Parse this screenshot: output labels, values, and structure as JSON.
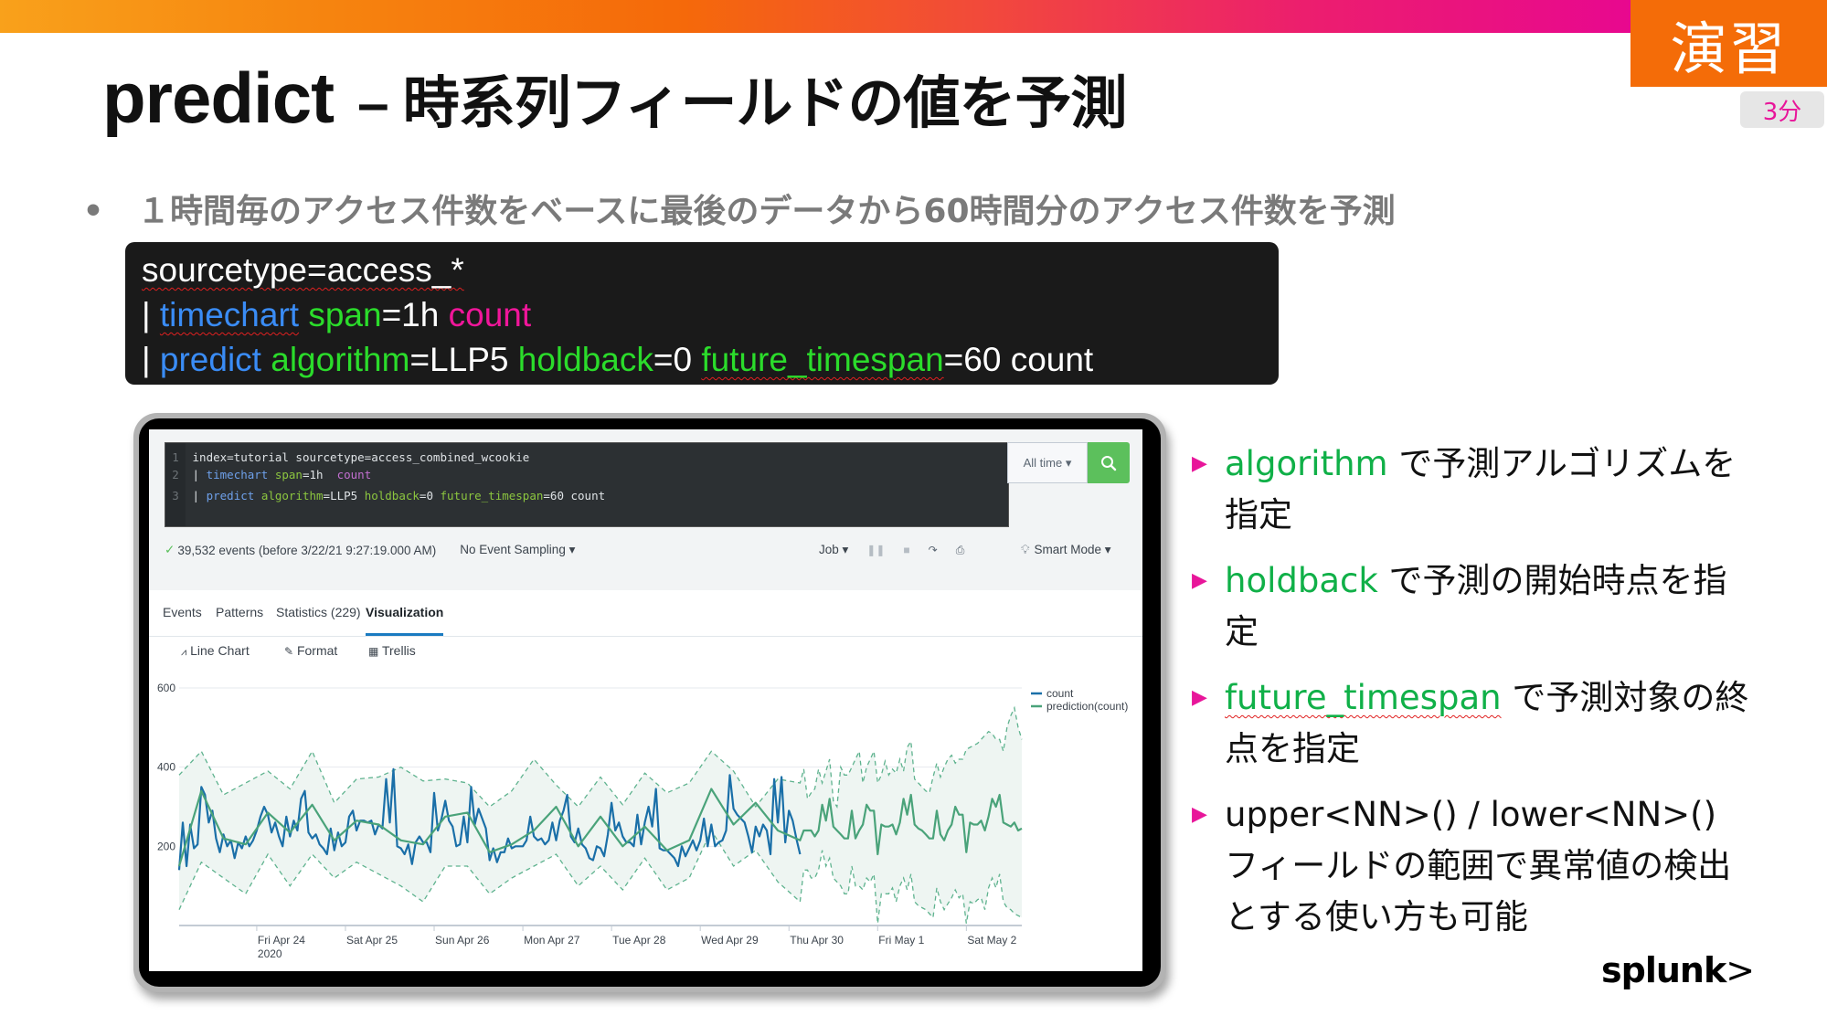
{
  "slide": {
    "title_main": "predict",
    "title_sub": "– 時系列フィールドの値を予測",
    "badge": "演習",
    "duration": "3分",
    "bullet_dot": "•",
    "bullet": "１時間毎のアクセス件数をベースに最後のデータから60時間分のアクセス件数を予測",
    "logo": "splunk",
    "logo_mark": ">"
  },
  "code": {
    "line1": {
      "text": "sourcetype=access_*"
    },
    "line2": {
      "pipe": "| ",
      "cmd": "timechart",
      "arg": "span",
      "val": "=1h ",
      "fn": "count"
    },
    "line3": {
      "pipe": "| ",
      "cmd": "predict",
      "a1": "algorithm",
      "v1": "=LLP5 ",
      "a2": "holdback",
      "v2": "=0 ",
      "a3": "future_timespan",
      "v3": "=60 count"
    }
  },
  "splunk_ui": {
    "search": {
      "lines": [
        {
          "n": "1",
          "text": "index=tutorial sourcetype=access_combined_wcookie"
        },
        {
          "n": "2",
          "pipe": "| ",
          "cmd": "timechart",
          "arg": "span",
          "rest": "=1h  ",
          "fn": "count"
        },
        {
          "n": "3",
          "pipe": "| ",
          "cmd": "predict",
          "a1": "algorithm",
          "v1": "=LLP5 ",
          "a2": "holdback",
          "v2": "=0 ",
          "a3": "future_timespan",
          "v3": "=60 count"
        }
      ],
      "time_range": "All time ▾",
      "search_icon": "search-icon"
    },
    "status": {
      "check": "✓",
      "events": "39,532 events (before 3/22/21 9:27:19.000 AM)",
      "sampling": "No Event Sampling ▾",
      "job": "Job ▾",
      "mode": "Smart Mode ▾"
    },
    "tabs": [
      {
        "label": "Events",
        "active": false
      },
      {
        "label": "Patterns",
        "active": false
      },
      {
        "label": "Statistics (229)",
        "active": false
      },
      {
        "label": "Visualization",
        "active": true
      }
    ],
    "viz_tools": [
      {
        "icon": "line-chart-icon",
        "glyph": "⩘",
        "label": "Line Chart"
      },
      {
        "icon": "pencil-icon",
        "glyph": "✎",
        "label": "Format"
      },
      {
        "icon": "trellis-icon",
        "glyph": "▦",
        "label": "Trellis"
      }
    ]
  },
  "right_bullets": [
    {
      "keyword": "algorithm",
      "text": " で予測アルゴリズムを指定"
    },
    {
      "keyword": "holdback",
      "text": " で予測の開始時点を指定"
    },
    {
      "keyword": "future_timespan",
      "text": " で予測対象の終点を指定"
    },
    {
      "keyword": "",
      "text": "upper<NN>() / lower<NN>() フィールドの範囲で異常値の検出とする使い方も可能"
    }
  ],
  "colors": {
    "accent_orange": "#f46c08",
    "accent_pink": "#e8169a",
    "keyword_green": "#10b048",
    "count_line": "#1a6fa8",
    "prediction_line": "#4aa37a",
    "search_button": "#5cc05c"
  },
  "chart_data": {
    "type": "line",
    "title": "",
    "xlabel": "",
    "ylabel": "",
    "ylim": [
      0,
      600
    ],
    "yticks": [
      200,
      400,
      600
    ],
    "grid": true,
    "legend": "right",
    "x_unit": "hours since axis start (Thu Apr 23 ~03:00, 2020)",
    "xlim": [
      0,
      228
    ],
    "xticks": [
      {
        "hour": 21,
        "label": "Fri Apr 24",
        "sub": "2020"
      },
      {
        "hour": 45,
        "label": "Sat Apr 25",
        "sub": ""
      },
      {
        "hour": 69,
        "label": "Sun Apr 26",
        "sub": ""
      },
      {
        "hour": 93,
        "label": "Mon Apr 27",
        "sub": ""
      },
      {
        "hour": 117,
        "label": "Tue Apr 28",
        "sub": ""
      },
      {
        "hour": 141,
        "label": "Wed Apr 29",
        "sub": ""
      },
      {
        "hour": 165,
        "label": "Thu Apr 30",
        "sub": ""
      },
      {
        "hour": 189,
        "label": "Fri May 1",
        "sub": ""
      },
      {
        "hour": 213,
        "label": "Sat May 2",
        "sub": ""
      }
    ],
    "series": [
      {
        "name": "count",
        "x": [
          0,
          1,
          2,
          3,
          4,
          5,
          6,
          7,
          8,
          9,
          10,
          11,
          12,
          13,
          14,
          15,
          16,
          17,
          18,
          19,
          20,
          21,
          22,
          23,
          24,
          25,
          26,
          27,
          28,
          29,
          30,
          31,
          32,
          33,
          34,
          35,
          36,
          37,
          38,
          39,
          40,
          41,
          42,
          43,
          44,
          45,
          46,
          47,
          48,
          49,
          50,
          51,
          52,
          53,
          54,
          55,
          56,
          57,
          58,
          59,
          60,
          61,
          62,
          63,
          64,
          65,
          66,
          67,
          68,
          69,
          70,
          71,
          72,
          73,
          74,
          75,
          76,
          77,
          78,
          79,
          80,
          81,
          82,
          83,
          84,
          85,
          86,
          87,
          88,
          89,
          90,
          91,
          92,
          93,
          94,
          95,
          96,
          97,
          98,
          99,
          100,
          101,
          102,
          103,
          104,
          105,
          106,
          107,
          108,
          109,
          110,
          111,
          112,
          113,
          114,
          115,
          116,
          117,
          118,
          119,
          120,
          121,
          122,
          123,
          124,
          125,
          126,
          127,
          128,
          129,
          130,
          131,
          132,
          133,
          134,
          135,
          136,
          137,
          138,
          139,
          140,
          141,
          142,
          143,
          144,
          145,
          146,
          147,
          148,
          149,
          150,
          151,
          152,
          153,
          154,
          155,
          156,
          157,
          158,
          159,
          160,
          161,
          162,
          163,
          164,
          165,
          166,
          167,
          168
        ],
        "values": [
          140,
          260,
          150,
          255,
          195,
          205,
          350,
          330,
          260,
          290,
          220,
          185,
          230,
          200,
          215,
          170,
          210,
          195,
          225,
          200,
          215,
          240,
          275,
          300,
          280,
          235,
          260,
          225,
          200,
          275,
          225,
          265,
          240,
          320,
          340,
          235,
          220,
          230,
          205,
          195,
          180,
          245,
          190,
          235,
          200,
          210,
          275,
          290,
          240,
          265,
          265,
          260,
          265,
          230,
          255,
          245,
          370,
          260,
          395,
          200,
          195,
          180,
          205,
          155,
          210,
          225,
          210,
          210,
          185,
          335,
          240,
          270,
          315,
          265,
          250,
          200,
          205,
          275,
          210,
          350,
          255,
          295,
          270,
          245,
          165,
          195,
          160,
          185,
          185,
          220,
          195,
          200,
          200,
          200,
          215,
          275,
          225,
          215,
          220,
          205,
          215,
          260,
          215,
          265,
          290,
          330,
          225,
          210,
          245,
          205,
          195,
          170,
          165,
          200,
          195,
          175,
          230,
          310,
          240,
          260,
          225,
          210,
          210,
          200,
          280,
          205,
          260,
          300,
          250,
          345,
          195,
          190,
          190,
          180,
          170,
          150,
          200,
          175,
          195,
          215,
          190,
          215,
          270,
          200,
          255,
          200,
          210,
          215,
          240,
          380,
          295,
          280,
          270,
          260,
          225,
          185,
          250,
          225,
          255,
          240,
          180,
          370,
          260,
          375,
          210,
          290,
          265,
          220,
          180
        ]
      },
      {
        "name": "prediction(count)",
        "x": [
          0,
          6,
          12,
          18,
          24,
          30,
          36,
          42,
          48,
          54,
          60,
          66,
          72,
          78,
          84,
          90,
          96,
          102,
          108,
          114,
          120,
          126,
          132,
          138,
          144,
          150,
          156,
          162,
          168,
          169,
          170,
          171,
          172,
          173,
          174,
          175,
          176,
          177,
          178,
          179,
          180,
          181,
          182,
          183,
          184,
          185,
          186,
          187,
          188,
          189,
          190,
          191,
          192,
          193,
          194,
          195,
          196,
          197,
          198,
          199,
          200,
          201,
          202,
          203,
          204,
          205,
          206,
          207,
          208,
          209,
          210,
          211,
          212,
          213,
          214,
          215,
          216,
          217,
          218,
          219,
          220,
          221,
          222,
          223,
          224,
          225,
          226,
          227,
          228
        ],
        "values": [
          150,
          340,
          220,
          205,
          285,
          235,
          305,
          215,
          265,
          255,
          215,
          205,
          275,
          285,
          185,
          205,
          240,
          300,
          200,
          275,
          200,
          250,
          190,
          215,
          345,
          255,
          310,
          240,
          215,
          240,
          240,
          240,
          225,
          240,
          305,
          265,
          320,
          250,
          240,
          230,
          220,
          220,
          290,
          220,
          240,
          255,
          305,
          290,
          290,
          180,
          255,
          250,
          250,
          255,
          230,
          260,
          320,
          280,
          330,
          255,
          245,
          240,
          230,
          220,
          220,
          290,
          230,
          215,
          240,
          255,
          300,
          280,
          280,
          185,
          260,
          255,
          255,
          265,
          240,
          275,
          320,
          300,
          330,
          260,
          255,
          250,
          260,
          240,
          245
        ],
        "band_upper": [
          380,
          440,
          330,
          360,
          390,
          345,
          440,
          310,
          370,
          375,
          400,
          365,
          370,
          360,
          300,
          340,
          420,
          355,
          300,
          375,
          305,
          385,
          335,
          360,
          440,
          390,
          300,
          370,
          360,
          395,
          320,
          335,
          345,
          395,
          360,
          390,
          420,
          315,
          300,
          400,
          380,
          380,
          400,
          420,
          440,
          360,
          400,
          420,
          440,
          360,
          380,
          415,
          380,
          395,
          385,
          420,
          390,
          450,
          465,
          370,
          360,
          350,
          340,
          335,
          375,
          410,
          375,
          400,
          420,
          430,
          410,
          420,
          420,
          445,
          450,
          455,
          460,
          470,
          480,
          490,
          485,
          470,
          470,
          440,
          500,
          530,
          550,
          500,
          470
        ],
        "band_lower": [
          40,
          160,
          120,
          80,
          180,
          100,
          180,
          120,
          160,
          130,
          100,
          60,
          150,
          150,
          80,
          120,
          150,
          180,
          100,
          150,
          90,
          170,
          90,
          120,
          240,
          150,
          190,
          110,
          60,
          140,
          140,
          120,
          120,
          140,
          190,
          150,
          170,
          120,
          110,
          100,
          80,
          80,
          150,
          100,
          100,
          90,
          120,
          110,
          130,
          5,
          80,
          80,
          80,
          95,
          60,
          100,
          120,
          90,
          130,
          60,
          50,
          45,
          40,
          30,
          20,
          95,
          60,
          40,
          55,
          70,
          90,
          70,
          80,
          5,
          60,
          55,
          65,
          70,
          40,
          95,
          120,
          95,
          130,
          60,
          45,
          40,
          30,
          25,
          20
        ]
      }
    ]
  }
}
